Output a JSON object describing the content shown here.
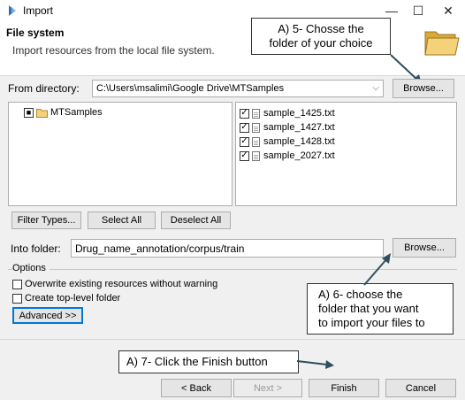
{
  "window": {
    "title": "Import",
    "minimize": "—",
    "maximize": "☐",
    "close": "✕"
  },
  "header": {
    "title": "File system",
    "description": "Import resources from the local file system."
  },
  "from_directory": {
    "label": "From directory:",
    "value": "C:\\Users\\msalimi\\Google Drive\\MTSamples",
    "browse_label": "Browse..."
  },
  "folder_tree": {
    "root_label": "MTSamples",
    "root_checked": "■"
  },
  "files": [
    {
      "name": "sample_1425.txt",
      "check": "✓"
    },
    {
      "name": "sample_1427.txt",
      "check": "✓"
    },
    {
      "name": "sample_1428.txt",
      "check": "✓"
    },
    {
      "name": "sample_2027.txt",
      "check": "✓"
    }
  ],
  "selection_buttons": {
    "filter_types": "Filter Types...",
    "select_all": "Select All",
    "deselect_all": "Deselect All"
  },
  "into_folder": {
    "label": "Into folder:",
    "value": "Drug_name_annotation/corpus/train",
    "browse_label": "Browse..."
  },
  "options": {
    "group_label": "Options",
    "overwrite_label": "Overwrite existing resources without warning",
    "create_top_level_label": "Create top-level folder",
    "advanced_label": "Advanced >>"
  },
  "footer": {
    "back_label": "< Back",
    "next_label": "Next >",
    "finish_label": "Finish",
    "cancel_label": "Cancel"
  },
  "annotations": {
    "callout_5_line1": "A) 5- Chosse the",
    "callout_5_line2": "folder of your choice",
    "callout_6_line1": "A) 6- choose the",
    "callout_6_line2": "folder that you want",
    "callout_6_line3": "to import your files to",
    "callout_7": "A) 7- Click the Finish button"
  },
  "colors": {
    "accent": "#0078d7",
    "folder_yellow": "#e8c35a"
  }
}
